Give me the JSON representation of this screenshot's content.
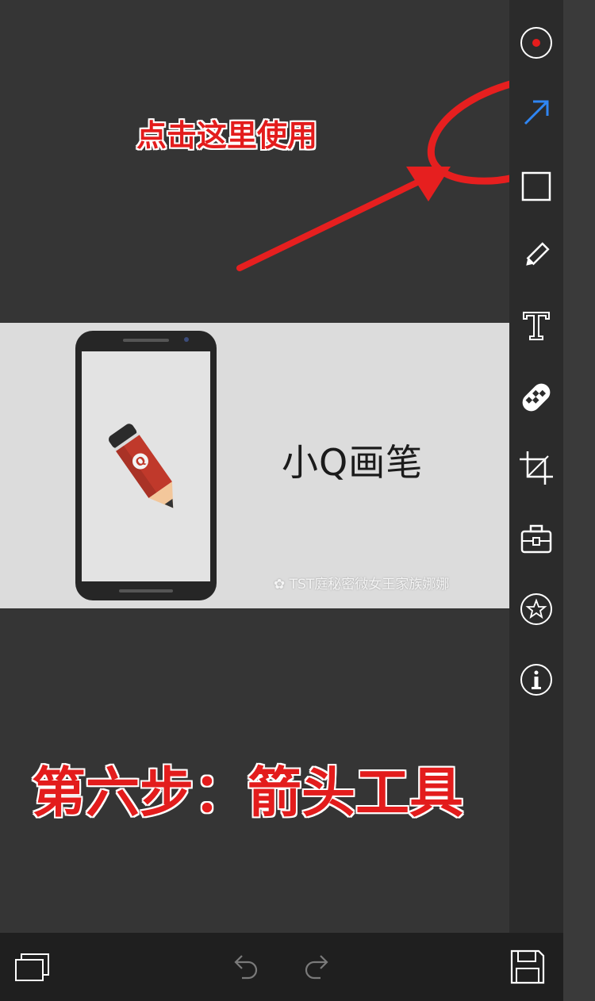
{
  "annotations": {
    "tap_here": "点击这里使用",
    "step_title": "第六步：箭头工具"
  },
  "image": {
    "brand_name": "小Q画笔",
    "watermark": "TST庭秘密微女王家族娜娜",
    "badge": "Q"
  },
  "toolbar": [
    {
      "id": "record",
      "icon": "record-icon",
      "active": false
    },
    {
      "id": "arrow",
      "icon": "arrow-icon",
      "active": true
    },
    {
      "id": "rectangle",
      "icon": "rectangle-icon",
      "active": false
    },
    {
      "id": "pencil",
      "icon": "pencil-icon",
      "active": false
    },
    {
      "id": "text",
      "icon": "text-icon",
      "active": false
    },
    {
      "id": "mosaic",
      "icon": "mosaic-icon",
      "active": false
    },
    {
      "id": "crop",
      "icon": "crop-icon",
      "active": false
    },
    {
      "id": "toolbox",
      "icon": "toolbox-icon",
      "active": false
    },
    {
      "id": "favorite",
      "icon": "star-icon",
      "active": false
    },
    {
      "id": "info",
      "icon": "info-icon",
      "active": false
    }
  ],
  "bottom_bar": {
    "icons": [
      "windows-icon",
      "undo-icon",
      "redo-icon",
      "save-icon"
    ]
  },
  "colors": {
    "annotation_red": "#e31c1c",
    "active_tool_blue": "#2f86f4",
    "toolbar_bg": "#2b2b2b",
    "canvas_bg": "#353535"
  }
}
